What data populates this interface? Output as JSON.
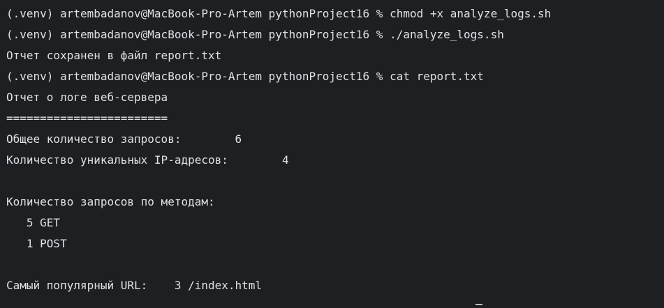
{
  "terminal": {
    "lines": [
      "(.venv) artembadanov@MacBook-Pro-Artem pythonProject16 % chmod +x analyze_logs.sh",
      "(.venv) artembadanov@MacBook-Pro-Artem pythonProject16 % ./analyze_logs.sh",
      "Отчет сохранен в файл report.txt",
      "(.venv) artembadanov@MacBook-Pro-Artem pythonProject16 % cat report.txt",
      "Отчет о логе веб-сервера",
      "========================",
      "Общее количество запросов:        6",
      "Количество уникальных IP-адресов:        4",
      "",
      "Количество запросов по методам:",
      "   5 GET",
      "   1 POST",
      "",
      "Самый популярный URL:    3 /index.html"
    ]
  },
  "colors": {
    "background": "#1e1f22",
    "text": "#dfe1e5"
  }
}
